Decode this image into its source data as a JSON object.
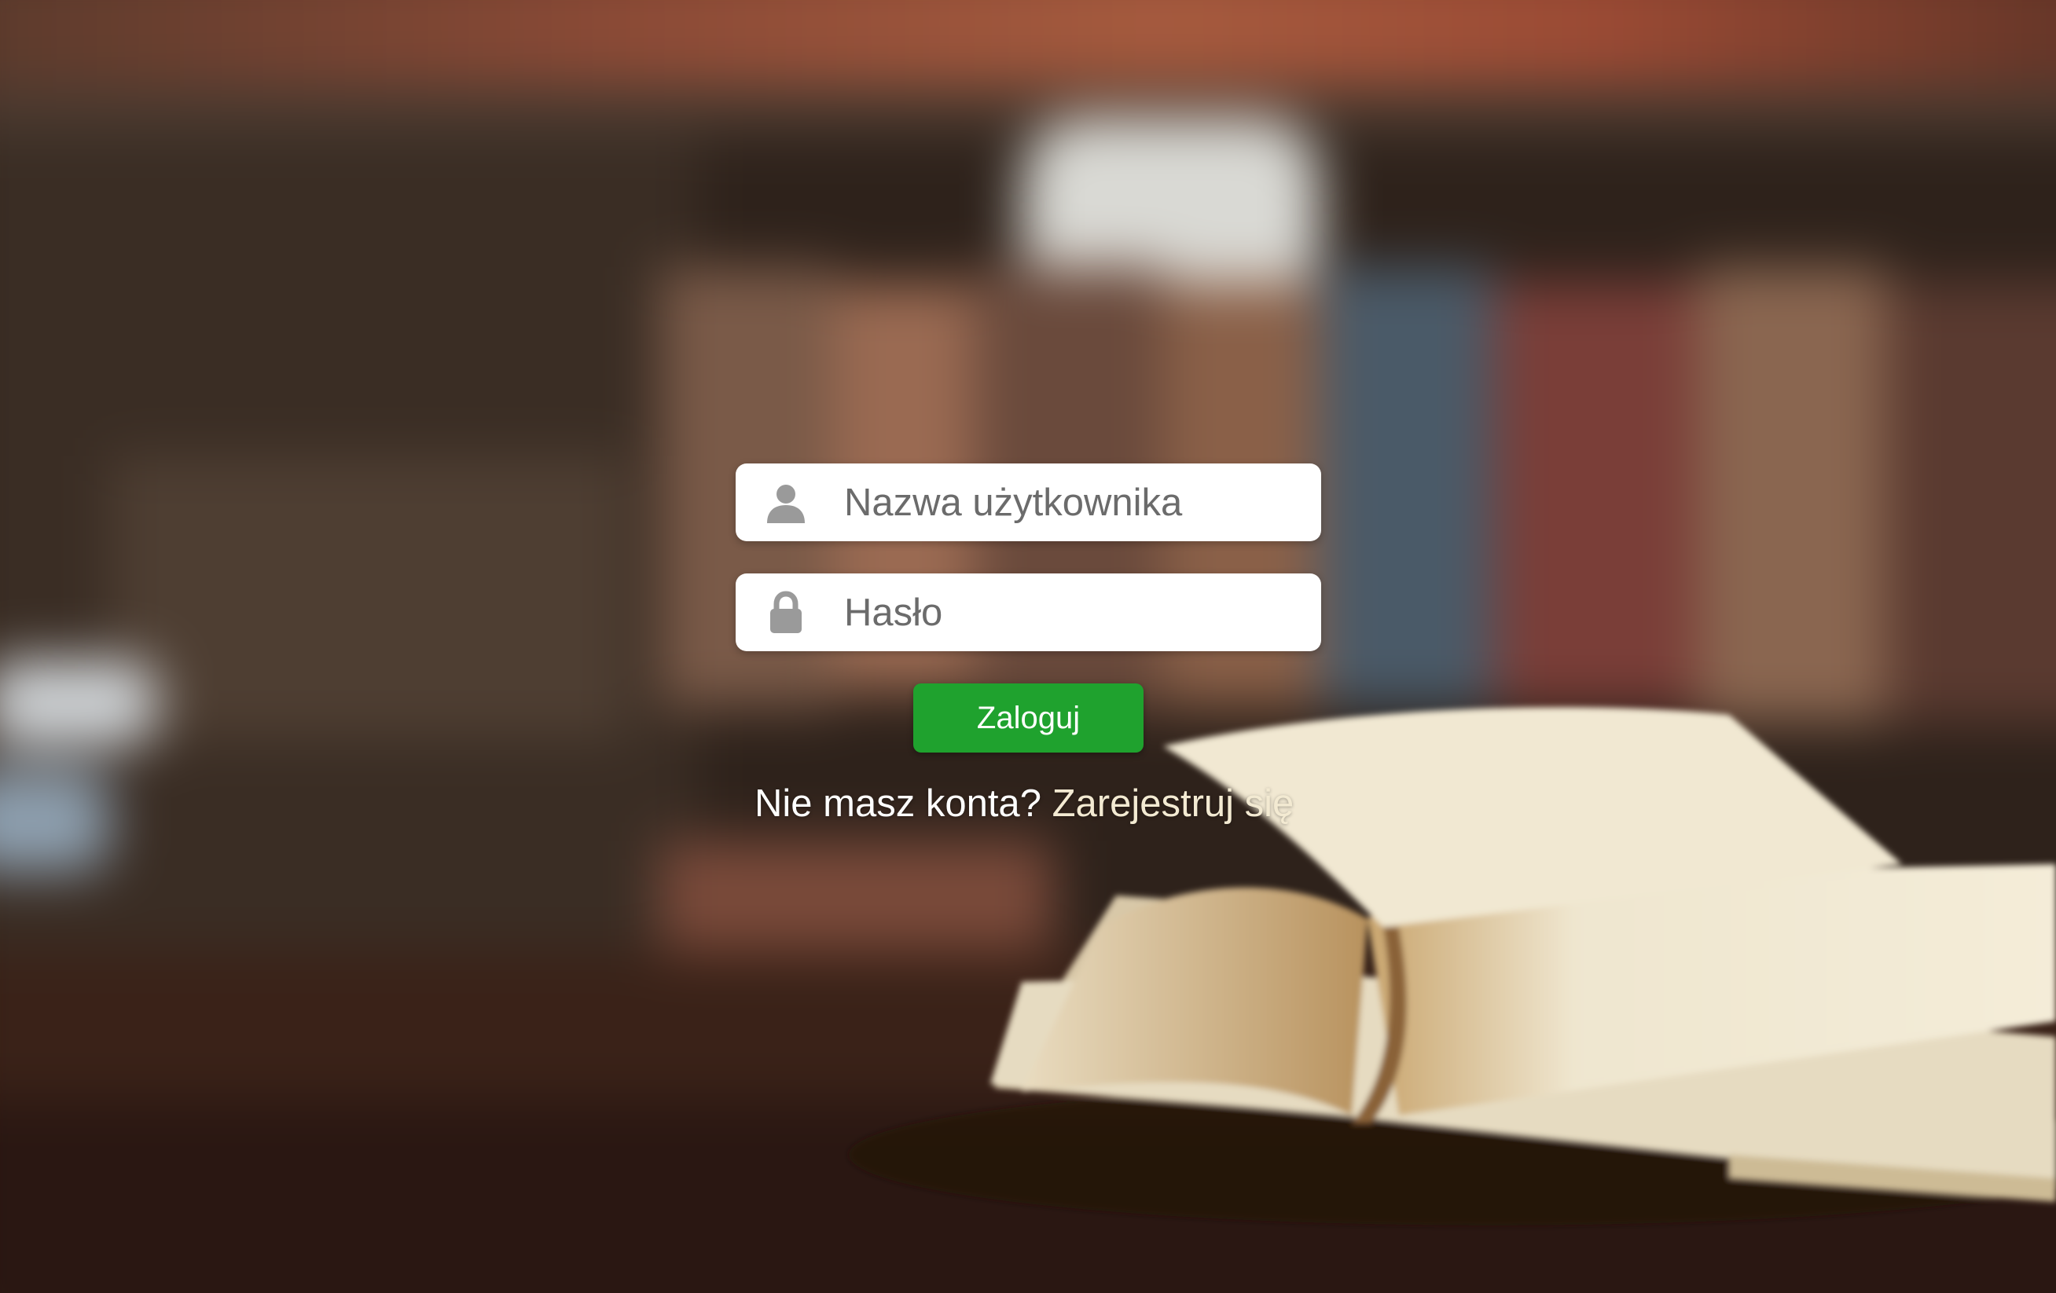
{
  "login_form": {
    "username_placeholder": "Nazwa użytkownika",
    "password_placeholder": "Hasło",
    "login_button_label": "Zaloguj",
    "no_account_text": "Nie masz konta?",
    "register_link_label": "Zarejestruj się"
  },
  "icons": {
    "username": "user-icon",
    "password": "lock-icon"
  },
  "colors": {
    "login_button": "#1fa22e",
    "field_background": "#ffffff",
    "icon": "#9a9a9a",
    "register_link": "#f3ead2"
  }
}
